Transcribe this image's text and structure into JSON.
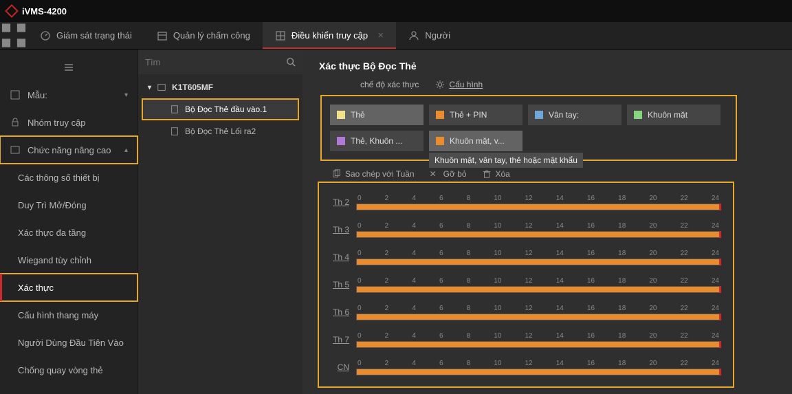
{
  "app": {
    "title": "iVMS-4200"
  },
  "tabs": [
    {
      "id": "status",
      "label": "Giám sát trạng thái",
      "icon": "gauge",
      "active": false
    },
    {
      "id": "time",
      "label": "Quản lý chấm công",
      "icon": "calendar",
      "active": false
    },
    {
      "id": "access",
      "label": "Điều khiển truy cập",
      "icon": "grid",
      "active": true
    },
    {
      "id": "person",
      "label": "Người",
      "icon": "person",
      "active": false
    }
  ],
  "sidebar": {
    "template": {
      "label": "Mẫu:"
    },
    "group": {
      "label": "Nhóm truy cập"
    },
    "advanced": {
      "label": "Chức năng nâng cao"
    },
    "subs": {
      "params": "Các thông số thiết bị",
      "keepopen": "Duy Trì Mở/Đóng",
      "multi": "Xác thực đa tầng",
      "wiegand": "Wiegand tùy chỉnh",
      "auth": "Xác thực",
      "elev": "Cấu hình thang máy",
      "firstin": "Người Dùng Đầu Tiên Vào",
      "antipb": "Chống quay vòng thẻ"
    }
  },
  "tree": {
    "search_placeholder": "Tìm",
    "device": "K1T605MF",
    "reader_in": "Bộ Đọc Thẻ đầu vào.1",
    "reader_out": "Bộ Đọc Thẻ Lối ra2"
  },
  "content": {
    "title": "Xác thực Bộ Đọc Thẻ",
    "mode_label": "chế độ xác thực",
    "config_label": "Cấu hình",
    "auth_modes": [
      {
        "key": "card",
        "label": "Thẻ",
        "color": "yellow",
        "sel": true
      },
      {
        "key": "cardpin",
        "label": "Thẻ + PIN",
        "color": "orange",
        "sel": false
      },
      {
        "key": "finger",
        "label": "Vân tay:",
        "color": "blue",
        "sel": false
      },
      {
        "key": "face",
        "label": "Khuôn mặt",
        "color": "green",
        "sel": false
      },
      {
        "key": "cardface",
        "label": "Thẻ, Khuôn ...",
        "color": "purple",
        "sel": false
      },
      {
        "key": "facefinger",
        "label": "Khuôn mặt, v...",
        "color": "or2",
        "sel": true,
        "tooltip": "Khuôn mặt, vân tay, thẻ hoặc mật khẩu"
      }
    ],
    "tools": {
      "copyweek": "Sao chép với Tuần",
      "remove": "Gỡ bỏ",
      "delete": "Xóa"
    },
    "ticks": [
      "0",
      "2",
      "4",
      "6",
      "8",
      "10",
      "12",
      "14",
      "16",
      "18",
      "20",
      "22",
      "24"
    ],
    "days": [
      {
        "key": "mon",
        "label": "Th 2"
      },
      {
        "key": "tue",
        "label": "Th 3"
      },
      {
        "key": "wed",
        "label": "Th 4"
      },
      {
        "key": "thu",
        "label": "Th 5"
      },
      {
        "key": "fri",
        "label": "Th 6"
      },
      {
        "key": "sat",
        "label": "Th 7"
      },
      {
        "key": "sun",
        "label": "CN"
      }
    ]
  }
}
